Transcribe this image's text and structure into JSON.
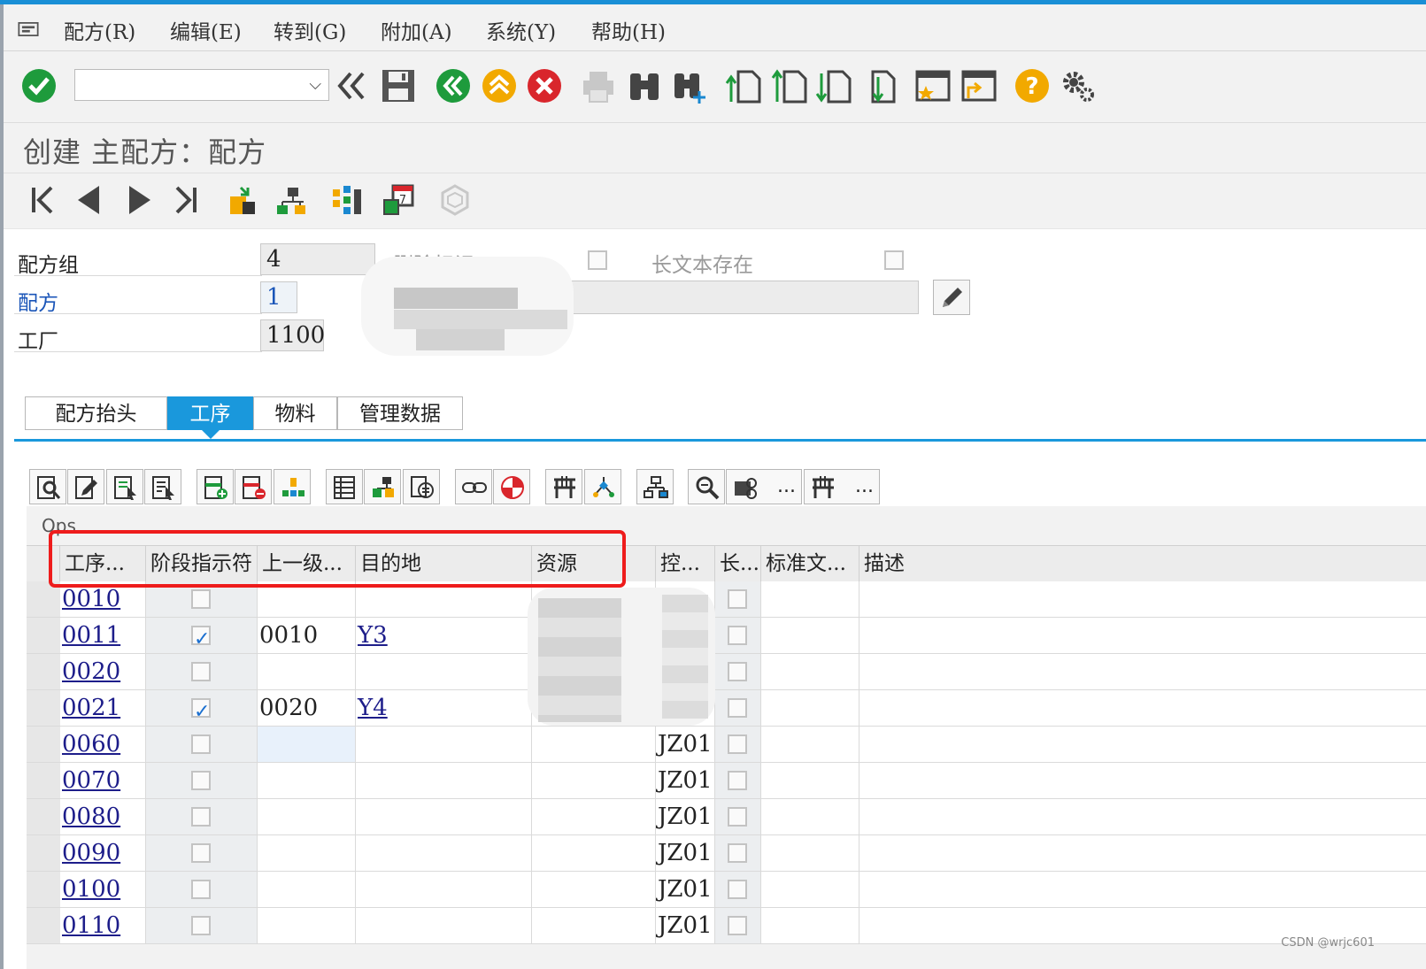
{
  "menubar": {
    "items": [
      {
        "label": "配方(R)"
      },
      {
        "label": "编辑(E)"
      },
      {
        "label": "转到(G)"
      },
      {
        "label": "附加(A)"
      },
      {
        "label": "系统(Y)"
      },
      {
        "label": "帮助(H)"
      }
    ]
  },
  "toolbar": {
    "command_value": "",
    "icons": [
      "enter-icon",
      "command-dropdown-icon",
      "collapse-icon",
      "save-icon",
      "back-icon",
      "exit-icon",
      "cancel-icon",
      "print-icon",
      "find-icon",
      "find-next-icon",
      "first-page-icon",
      "previous-page-icon",
      "next-page-icon",
      "last-page-icon",
      "create-session-icon",
      "shortcut-icon",
      "help-icon",
      "settings-icon"
    ],
    "colors": {
      "enter": "#1e9b3c",
      "back": "#1e9b3c",
      "exit": "#f2a900",
      "cancel": "#d9262c",
      "help": "#f2a900"
    }
  },
  "title": "创建 主配方：配方",
  "header": {
    "recipe_group_label": "配方组",
    "recipe_group_value": "4",
    "recipe_label": "配方",
    "recipe_value": "1",
    "plant_label": "工厂",
    "plant_value": "1100",
    "deletion_flag_label": "删除标记",
    "long_text_label": "长文本存在"
  },
  "tabs": [
    {
      "label": "配方抬头",
      "active": false
    },
    {
      "label": "工序",
      "active": true
    },
    {
      "label": "物料",
      "active": false
    },
    {
      "label": "管理数据",
      "active": false
    }
  ],
  "table_toolbar": {
    "more_label": "..."
  },
  "grid": {
    "title": "Ops",
    "columns": [
      "工序...",
      "阶段指示符",
      "上一级...",
      "目的地",
      "资源",
      "控...",
      "长...",
      "标准文...",
      "描述"
    ],
    "rows": [
      {
        "op": "0010",
        "phase": false,
        "parent": "",
        "dest": "",
        "control": "",
        "longtext": false
      },
      {
        "op": "0011",
        "phase": true,
        "parent": "0010",
        "dest": "Y3",
        "control": "",
        "longtext": false
      },
      {
        "op": "0020",
        "phase": false,
        "parent": "",
        "dest": "",
        "control": "",
        "longtext": false
      },
      {
        "op": "0021",
        "phase": true,
        "parent": "0020",
        "dest": "Y4",
        "control": "",
        "longtext": false
      },
      {
        "op": "0060",
        "phase": false,
        "parent": "",
        "dest": "",
        "control": "JZ01",
        "longtext": false
      },
      {
        "op": "0070",
        "phase": false,
        "parent": "",
        "dest": "",
        "control": "JZ01",
        "longtext": false
      },
      {
        "op": "0080",
        "phase": false,
        "parent": "",
        "dest": "",
        "control": "JZ01",
        "longtext": false
      },
      {
        "op": "0090",
        "phase": false,
        "parent": "",
        "dest": "",
        "control": "JZ01",
        "longtext": false
      },
      {
        "op": "0100",
        "phase": false,
        "parent": "",
        "dest": "",
        "control": "JZ01",
        "longtext": false
      },
      {
        "op": "0110",
        "phase": false,
        "parent": "",
        "dest": "",
        "control": "JZ01",
        "longtext": false
      }
    ]
  },
  "watermark": "CSDN @wrjc601"
}
